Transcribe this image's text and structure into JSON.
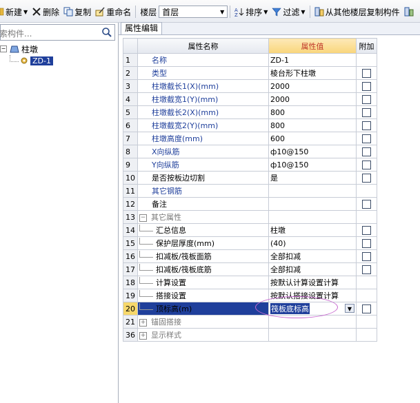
{
  "toolbar": {
    "new_label": "新建",
    "delete_label": "删除",
    "copy_label": "复制",
    "rename_label": "重命名",
    "floor_label": "楼层",
    "floor_value": "首层",
    "sort_label": "排序",
    "filter_label": "过滤",
    "copy_from_floor_label": "从其他楼层复制构件"
  },
  "left_panel": {
    "search_placeholder": "索构件...",
    "tree": {
      "group_label": "柱墩",
      "item_label": "ZD-1"
    }
  },
  "right_panel": {
    "tab_label": "属性编辑",
    "columns": {
      "name": "属性名称",
      "value": "属性值",
      "extra": "附加"
    },
    "rows": [
      {
        "num": "1",
        "name": "名称",
        "value": "ZD-1",
        "checkbox": false
      },
      {
        "num": "2",
        "name": "类型",
        "value": "棱台形下柱墩",
        "checkbox": true
      },
      {
        "num": "3",
        "name": "柱墩截长1(X)(mm)",
        "value": "2000",
        "checkbox": true
      },
      {
        "num": "4",
        "name": "柱墩截宽1(Y)(mm)",
        "value": "2000",
        "checkbox": true
      },
      {
        "num": "5",
        "name": "柱墩截长2(X)(mm)",
        "value": "800",
        "checkbox": true
      },
      {
        "num": "6",
        "name": "柱墩截宽2(Y)(mm)",
        "value": "800",
        "checkbox": true
      },
      {
        "num": "7",
        "name": "柱墩高度(mm)",
        "value": "600",
        "checkbox": true
      },
      {
        "num": "8",
        "name": "X向纵筋",
        "value": "ф10@150",
        "checkbox": true
      },
      {
        "num": "9",
        "name": "Y向纵筋",
        "value": "ф10@150",
        "checkbox": true
      },
      {
        "num": "10",
        "name": "是否按板边切割",
        "value": "是",
        "checkbox": true
      },
      {
        "num": "11",
        "name": "其它钢筋",
        "value": "",
        "checkbox": false
      },
      {
        "num": "12",
        "name": "备注",
        "value": "",
        "checkbox": true
      },
      {
        "num": "13",
        "name": "其它属性",
        "value": "",
        "checkbox": false
      },
      {
        "num": "14",
        "name": "汇总信息",
        "value": "柱墩",
        "checkbox": true
      },
      {
        "num": "15",
        "name": "保护层厚度(mm)",
        "value": "(40)",
        "checkbox": true
      },
      {
        "num": "16",
        "name": "扣减板/筏板面筋",
        "value": "全部扣减",
        "checkbox": true
      },
      {
        "num": "17",
        "name": "扣减板/筏板底筋",
        "value": "全部扣减",
        "checkbox": true
      },
      {
        "num": "18",
        "name": "计算设置",
        "value": "按默认计算设置计算",
        "checkbox": false
      },
      {
        "num": "19",
        "name": "搭接设置",
        "value": "按默认搭接设置计算",
        "checkbox": false
      },
      {
        "num": "20",
        "name": "顶标高(m)",
        "value": "筏板底标高",
        "checkbox": true
      },
      {
        "num": "21",
        "name": "锚固搭接",
        "value": "",
        "checkbox": false
      },
      {
        "num": "36",
        "name": "显示样式",
        "value": "",
        "checkbox": false
      }
    ]
  },
  "colors": {
    "selection": "#1f3f9b",
    "header_highlight": "#f9d57a",
    "name_text": "#1f3f9b",
    "annotation_ellipse": "#c86ad0"
  }
}
